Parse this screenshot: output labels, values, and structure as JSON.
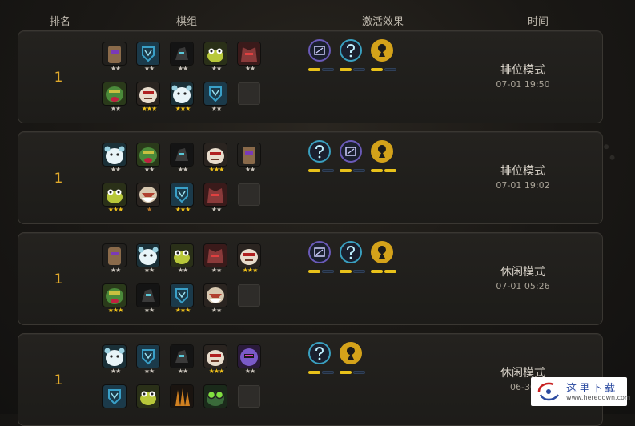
{
  "header": {
    "rank": "排名",
    "lineup": "棋组",
    "traits": "激活效果",
    "time": "时间"
  },
  "records": [
    {
      "rank": "1",
      "mode": "排位模式",
      "time": "07-01 19:50",
      "pieces": [
        {
          "icon": "brown-hood-icon",
          "stars": 2,
          "color": "#8a6a4a"
        },
        {
          "icon": "blue-shield-icon",
          "stars": 2,
          "color": "#3aa0c8"
        },
        {
          "icon": "dark-knight-icon",
          "stars": 2,
          "color": "#2d2d2d"
        },
        {
          "icon": "yellow-frog-icon",
          "stars": 2,
          "color": "#b8c83a"
        },
        {
          "icon": "red-ogre-icon",
          "stars": 2,
          "color": "#8a3a3a"
        },
        {
          "icon": "green-troll-icon",
          "stars": 2,
          "color": "#4a8a3a"
        },
        {
          "icon": "white-yeti-icon",
          "stars": 3,
          "color": "#c8a890"
        },
        {
          "icon": "white-bear-icon",
          "stars": 3,
          "color": "#9ad0e0"
        },
        {
          "icon": "blue-shield-icon",
          "stars": 2,
          "color": "#3aa0c8"
        },
        {
          "icon": "empty-slot",
          "stars": 0,
          "color": ""
        }
      ],
      "traits": [
        {
          "icon": "purple-tome-icon",
          "color": "#6a5ab8",
          "level": 1,
          "max": 2
        },
        {
          "icon": "cyan-question-icon",
          "color": "#3aa0c0",
          "level": 1,
          "max": 2
        },
        {
          "icon": "gold-emblem-icon",
          "color": "#d4a21a",
          "level": 1,
          "max": 2
        }
      ]
    },
    {
      "rank": "1",
      "mode": "排位模式",
      "time": "07-01 19:02",
      "pieces": [
        {
          "icon": "white-bear-icon",
          "stars": 2,
          "color": "#9ad0e0"
        },
        {
          "icon": "green-troll-icon",
          "stars": 2,
          "color": "#4a8a3a"
        },
        {
          "icon": "dark-knight-icon",
          "stars": 2,
          "color": "#2d2d2d"
        },
        {
          "icon": "white-yeti-icon",
          "stars": 3,
          "color": "#c8a890"
        },
        {
          "icon": "brown-hood-icon",
          "stars": 2,
          "color": "#8a6a4a"
        },
        {
          "icon": "yellow-frog-icon",
          "stars": 3,
          "color": "#b8c83a"
        },
        {
          "icon": "white-beard-icon",
          "stars": 1,
          "color": "#d8c8b0"
        },
        {
          "icon": "blue-shield-icon",
          "stars": 3,
          "color": "#3aa0c8"
        },
        {
          "icon": "red-ogre-icon",
          "stars": 2,
          "color": "#8a3a3a"
        },
        {
          "icon": "empty-slot",
          "stars": 0,
          "color": ""
        }
      ],
      "traits": [
        {
          "icon": "cyan-question-icon",
          "color": "#3aa0c0",
          "level": 1,
          "max": 2
        },
        {
          "icon": "purple-tome-icon",
          "color": "#6a5ab8",
          "level": 1,
          "max": 2
        },
        {
          "icon": "gold-emblem-icon",
          "color": "#d4a21a",
          "level": 2,
          "max": 2
        }
      ]
    },
    {
      "rank": "1",
      "mode": "休闲模式",
      "time": "07-01 05:26",
      "pieces": [
        {
          "icon": "brown-hood-icon",
          "stars": 2,
          "color": "#8a6a4a"
        },
        {
          "icon": "white-bear-icon",
          "stars": 2,
          "color": "#9ad0e0"
        },
        {
          "icon": "yellow-frog-icon",
          "stars": 2,
          "color": "#b8c83a"
        },
        {
          "icon": "red-ogre-icon",
          "stars": 2,
          "color": "#8a3a3a"
        },
        {
          "icon": "white-yeti-icon",
          "stars": 3,
          "color": "#c8a890"
        },
        {
          "icon": "green-troll-icon",
          "stars": 3,
          "color": "#4a8a3a"
        },
        {
          "icon": "dark-knight-icon",
          "stars": 2,
          "color": "#2d2d2d"
        },
        {
          "icon": "blue-shield-icon",
          "stars": 3,
          "color": "#3aa0c8"
        },
        {
          "icon": "white-beard-icon",
          "stars": 2,
          "color": "#d8c8b0"
        },
        {
          "icon": "empty-slot",
          "stars": 0,
          "color": ""
        }
      ],
      "traits": [
        {
          "icon": "purple-tome-icon",
          "color": "#6a5ab8",
          "level": 1,
          "max": 2
        },
        {
          "icon": "cyan-question-icon",
          "color": "#3aa0c0",
          "level": 1,
          "max": 2
        },
        {
          "icon": "gold-emblem-icon",
          "color": "#d4a21a",
          "level": 2,
          "max": 2
        }
      ]
    },
    {
      "rank": "1",
      "mode": "休闲模式",
      "time": "06-30",
      "pieces": [
        {
          "icon": "white-bear-icon",
          "stars": 2,
          "color": "#9ad0e0"
        },
        {
          "icon": "blue-shield-icon",
          "stars": 2,
          "color": "#3aa0c8"
        },
        {
          "icon": "dark-knight-icon",
          "stars": 2,
          "color": "#2d2d2d"
        },
        {
          "icon": "white-yeti-icon",
          "stars": 3,
          "color": "#c8a890"
        },
        {
          "icon": "purple-mage-icon",
          "stars": 2,
          "color": "#7a5ac8"
        },
        {
          "icon": "blue-shield-icon",
          "stars": 0,
          "color": "#3aa0c8"
        },
        {
          "icon": "yellow-frog-icon",
          "stars": 0,
          "color": "#b8c83a"
        },
        {
          "icon": "orange-claw-icon",
          "stars": 0,
          "color": "#d08020"
        },
        {
          "icon": "green-goggle-icon",
          "stars": 0,
          "color": "#4aa04a"
        },
        {
          "icon": "empty-slot",
          "stars": 0,
          "color": ""
        }
      ],
      "traits": [
        {
          "icon": "cyan-question-icon",
          "color": "#3aa0c0",
          "level": 1,
          "max": 2
        },
        {
          "icon": "gold-emblem-icon",
          "color": "#d4a21a",
          "level": 1,
          "max": 2
        }
      ]
    }
  ],
  "watermark": {
    "title": "这里下载",
    "url": "www.heredown.com"
  }
}
